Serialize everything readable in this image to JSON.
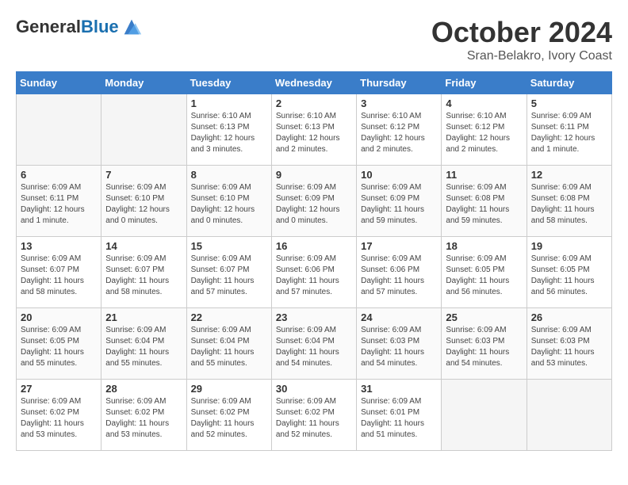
{
  "header": {
    "logo_general": "General",
    "logo_blue": "Blue",
    "month": "October 2024",
    "location": "Sran-Belakro, Ivory Coast"
  },
  "days_of_week": [
    "Sunday",
    "Monday",
    "Tuesday",
    "Wednesday",
    "Thursday",
    "Friday",
    "Saturday"
  ],
  "weeks": [
    [
      {
        "num": "",
        "info": ""
      },
      {
        "num": "",
        "info": ""
      },
      {
        "num": "1",
        "info": "Sunrise: 6:10 AM\nSunset: 6:13 PM\nDaylight: 12 hours\nand 3 minutes."
      },
      {
        "num": "2",
        "info": "Sunrise: 6:10 AM\nSunset: 6:13 PM\nDaylight: 12 hours\nand 2 minutes."
      },
      {
        "num": "3",
        "info": "Sunrise: 6:10 AM\nSunset: 6:12 PM\nDaylight: 12 hours\nand 2 minutes."
      },
      {
        "num": "4",
        "info": "Sunrise: 6:10 AM\nSunset: 6:12 PM\nDaylight: 12 hours\nand 2 minutes."
      },
      {
        "num": "5",
        "info": "Sunrise: 6:09 AM\nSunset: 6:11 PM\nDaylight: 12 hours\nand 1 minute."
      }
    ],
    [
      {
        "num": "6",
        "info": "Sunrise: 6:09 AM\nSunset: 6:11 PM\nDaylight: 12 hours\nand 1 minute."
      },
      {
        "num": "7",
        "info": "Sunrise: 6:09 AM\nSunset: 6:10 PM\nDaylight: 12 hours\nand 0 minutes."
      },
      {
        "num": "8",
        "info": "Sunrise: 6:09 AM\nSunset: 6:10 PM\nDaylight: 12 hours\nand 0 minutes."
      },
      {
        "num": "9",
        "info": "Sunrise: 6:09 AM\nSunset: 6:09 PM\nDaylight: 12 hours\nand 0 minutes."
      },
      {
        "num": "10",
        "info": "Sunrise: 6:09 AM\nSunset: 6:09 PM\nDaylight: 11 hours\nand 59 minutes."
      },
      {
        "num": "11",
        "info": "Sunrise: 6:09 AM\nSunset: 6:08 PM\nDaylight: 11 hours\nand 59 minutes."
      },
      {
        "num": "12",
        "info": "Sunrise: 6:09 AM\nSunset: 6:08 PM\nDaylight: 11 hours\nand 58 minutes."
      }
    ],
    [
      {
        "num": "13",
        "info": "Sunrise: 6:09 AM\nSunset: 6:07 PM\nDaylight: 11 hours\nand 58 minutes."
      },
      {
        "num": "14",
        "info": "Sunrise: 6:09 AM\nSunset: 6:07 PM\nDaylight: 11 hours\nand 58 minutes."
      },
      {
        "num": "15",
        "info": "Sunrise: 6:09 AM\nSunset: 6:07 PM\nDaylight: 11 hours\nand 57 minutes."
      },
      {
        "num": "16",
        "info": "Sunrise: 6:09 AM\nSunset: 6:06 PM\nDaylight: 11 hours\nand 57 minutes."
      },
      {
        "num": "17",
        "info": "Sunrise: 6:09 AM\nSunset: 6:06 PM\nDaylight: 11 hours\nand 57 minutes."
      },
      {
        "num": "18",
        "info": "Sunrise: 6:09 AM\nSunset: 6:05 PM\nDaylight: 11 hours\nand 56 minutes."
      },
      {
        "num": "19",
        "info": "Sunrise: 6:09 AM\nSunset: 6:05 PM\nDaylight: 11 hours\nand 56 minutes."
      }
    ],
    [
      {
        "num": "20",
        "info": "Sunrise: 6:09 AM\nSunset: 6:05 PM\nDaylight: 11 hours\nand 55 minutes."
      },
      {
        "num": "21",
        "info": "Sunrise: 6:09 AM\nSunset: 6:04 PM\nDaylight: 11 hours\nand 55 minutes."
      },
      {
        "num": "22",
        "info": "Sunrise: 6:09 AM\nSunset: 6:04 PM\nDaylight: 11 hours\nand 55 minutes."
      },
      {
        "num": "23",
        "info": "Sunrise: 6:09 AM\nSunset: 6:04 PM\nDaylight: 11 hours\nand 54 minutes."
      },
      {
        "num": "24",
        "info": "Sunrise: 6:09 AM\nSunset: 6:03 PM\nDaylight: 11 hours\nand 54 minutes."
      },
      {
        "num": "25",
        "info": "Sunrise: 6:09 AM\nSunset: 6:03 PM\nDaylight: 11 hours\nand 54 minutes."
      },
      {
        "num": "26",
        "info": "Sunrise: 6:09 AM\nSunset: 6:03 PM\nDaylight: 11 hours\nand 53 minutes."
      }
    ],
    [
      {
        "num": "27",
        "info": "Sunrise: 6:09 AM\nSunset: 6:02 PM\nDaylight: 11 hours\nand 53 minutes."
      },
      {
        "num": "28",
        "info": "Sunrise: 6:09 AM\nSunset: 6:02 PM\nDaylight: 11 hours\nand 53 minutes."
      },
      {
        "num": "29",
        "info": "Sunrise: 6:09 AM\nSunset: 6:02 PM\nDaylight: 11 hours\nand 52 minutes."
      },
      {
        "num": "30",
        "info": "Sunrise: 6:09 AM\nSunset: 6:02 PM\nDaylight: 11 hours\nand 52 minutes."
      },
      {
        "num": "31",
        "info": "Sunrise: 6:09 AM\nSunset: 6:01 PM\nDaylight: 11 hours\nand 51 minutes."
      },
      {
        "num": "",
        "info": ""
      },
      {
        "num": "",
        "info": ""
      }
    ]
  ]
}
